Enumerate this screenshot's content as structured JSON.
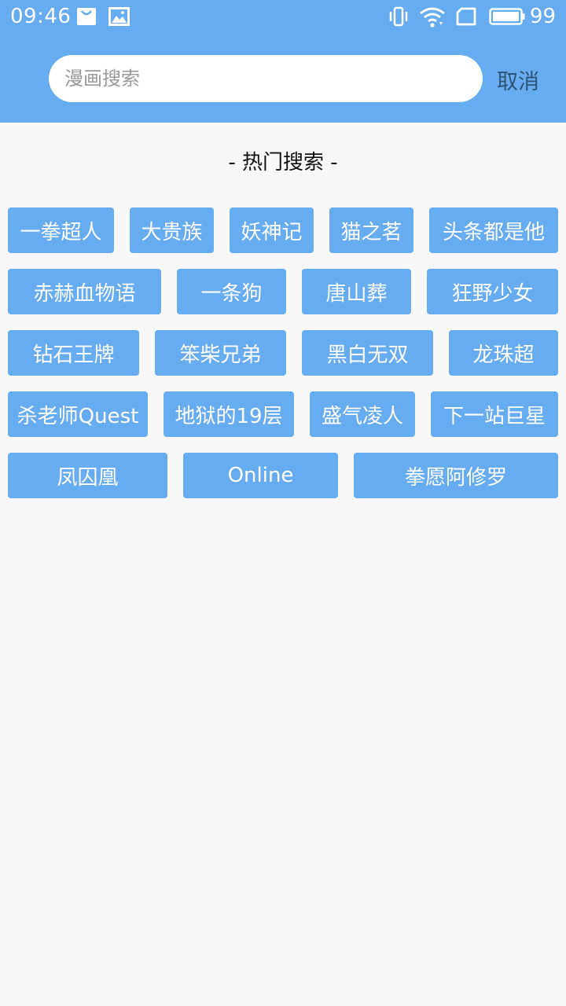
{
  "status_bar": {
    "time": "09:46",
    "battery_level": "99",
    "icons_left": [
      "shopping-bag-icon",
      "image-icon"
    ],
    "icons_right": [
      "vibrate-icon",
      "wifi-icon",
      "sim-card-icon",
      "battery-icon"
    ]
  },
  "search": {
    "placeholder": "漫画搜索",
    "value": "",
    "cancel_label": "取消"
  },
  "hot_search": {
    "title": "- 热门搜索 -",
    "rows": [
      [
        "一拳超人",
        "大贵族",
        "妖神记",
        "猫之茗",
        "头条都是他"
      ],
      [
        "赤赫血物语",
        "一条狗",
        "唐山葬",
        "狂野少女"
      ],
      [
        "钻石王牌",
        "笨柴兄弟",
        "黑白无双",
        "龙珠超"
      ],
      [
        "杀老师Quest",
        "地狱的19层",
        "盛气凌人",
        "下一站巨星"
      ],
      [
        "凤囚凰",
        "Online",
        "拳愿阿修罗"
      ]
    ]
  },
  "colors": {
    "accent": "#65acf0",
    "background": "#f8f8f8",
    "cancel_text": "#2e5475",
    "tag_text": "#ffffff"
  }
}
